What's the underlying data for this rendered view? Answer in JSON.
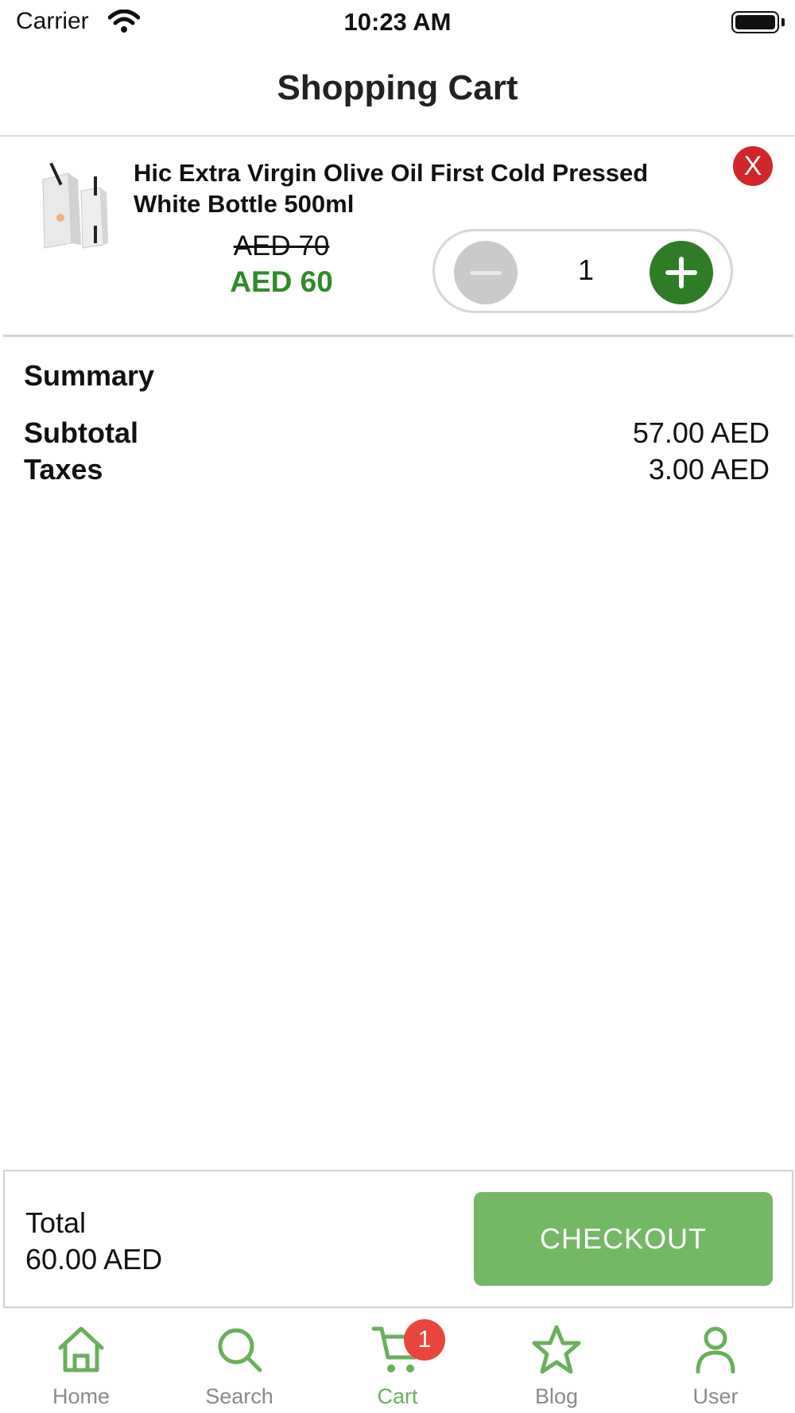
{
  "status_bar": {
    "carrier": "Carrier",
    "time": "10:23 AM"
  },
  "header": {
    "title": "Shopping Cart"
  },
  "cart": {
    "items": [
      {
        "name": "Hic Extra Virgin Olive Oil First Cold Pressed White Bottle 500ml",
        "old_price": "AED 70",
        "price": "AED 60",
        "quantity": "1",
        "remove_label": "X"
      }
    ]
  },
  "summary": {
    "title": "Summary",
    "rows": [
      {
        "label": "Subtotal",
        "value": "57.00 AED"
      },
      {
        "label": "Taxes",
        "value": "3.00 AED"
      }
    ]
  },
  "checkout": {
    "total_label": "Total",
    "total_value": "60.00 AED",
    "button_label": "CHECKOUT"
  },
  "tab_bar": {
    "tabs": [
      {
        "label": "Home",
        "icon": "home-icon"
      },
      {
        "label": "Search",
        "icon": "search-icon"
      },
      {
        "label": "Cart",
        "icon": "cart-icon",
        "badge": "1",
        "active": true
      },
      {
        "label": "Blog",
        "icon": "star-icon"
      },
      {
        "label": "User",
        "icon": "user-icon"
      }
    ]
  },
  "colors": {
    "accent_green": "#74b765",
    "price_green": "#2f8b2a",
    "plus_button": "#2e7d26",
    "remove_red": "#d0262a",
    "badge_red": "#e8453c",
    "inactive_tab": "#8a8a8a"
  }
}
